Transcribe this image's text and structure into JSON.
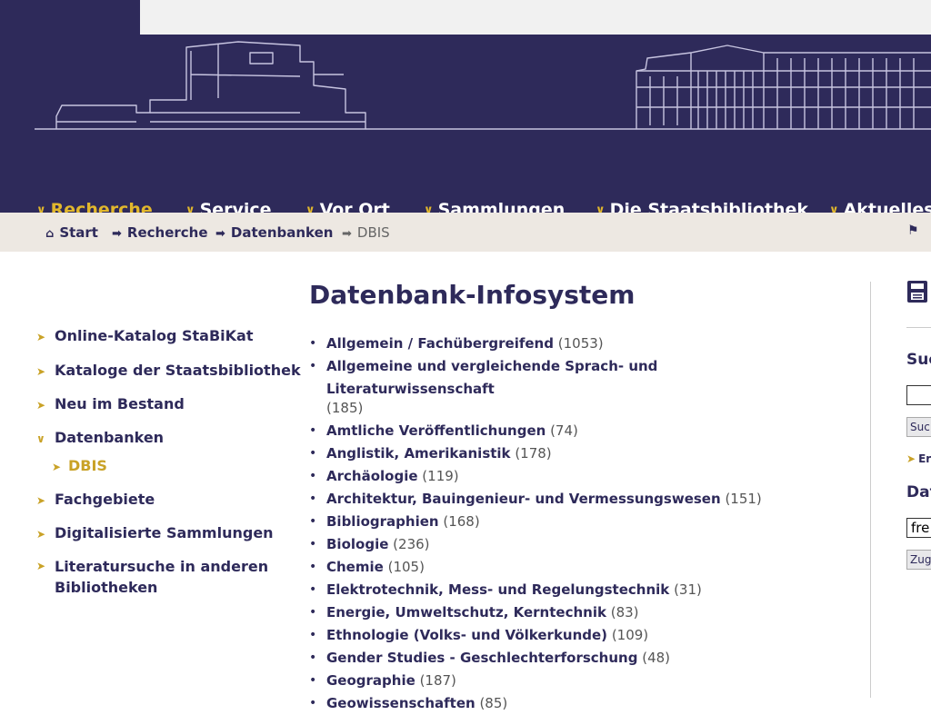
{
  "main_nav": [
    {
      "label": "Recherche",
      "active": true
    },
    {
      "label": "Service",
      "active": false
    },
    {
      "label": "Vor Ort",
      "active": false
    },
    {
      "label": "Sammlungen",
      "active": false
    },
    {
      "label": "Die Staatsbibliothek",
      "active": false
    },
    {
      "label": "Aktuelles",
      "active": false
    }
  ],
  "breadcrumb": [
    "Start",
    "Recherche",
    "Datenbanken",
    "DBIS"
  ],
  "sidebar": {
    "items": [
      {
        "label": "Online-Katalog StaBiKat"
      },
      {
        "label": "Kataloge der Staatsbibliothek"
      },
      {
        "label": "Neu im Bestand"
      },
      {
        "label": "Datenbanken",
        "expanded": true
      },
      {
        "label": "Fachgebiete"
      },
      {
        "label": "Digitalisierte Sammlungen"
      },
      {
        "label": "Literatursuche in anderen Bibliotheken"
      }
    ],
    "sub_item": "DBIS"
  },
  "page_title": "Datenbank-Infosystem",
  "subjects": [
    {
      "name": "Allgemein / Fachübergreifend",
      "count": "(1053)"
    },
    {
      "name": "Allgemeine und vergleichende Sprach- und Literaturwissenschaft",
      "count": "(185)"
    },
    {
      "name": "Amtliche Veröffentlichungen",
      "count": "(74)"
    },
    {
      "name": "Anglistik, Amerikanistik",
      "count": "(178)"
    },
    {
      "name": "Archäologie",
      "count": "(119)"
    },
    {
      "name": "Architektur, Bauingenieur- und Vermessungswesen",
      "count": "(151)"
    },
    {
      "name": "Bibliographien",
      "count": "(168)"
    },
    {
      "name": "Biologie",
      "count": "(236)"
    },
    {
      "name": "Chemie",
      "count": "(105)"
    },
    {
      "name": "Elektrotechnik, Mess- und Regelungstechnik",
      "count": "(31)"
    },
    {
      "name": "Energie, Umweltschutz, Kerntechnik",
      "count": "(83)"
    },
    {
      "name": "Ethnologie (Volks- und Völkerkunde)",
      "count": "(109)"
    },
    {
      "name": "Gender Studies - Geschlechterforschung",
      "count": "(48)"
    },
    {
      "name": "Geographie",
      "count": "(187)"
    },
    {
      "name": "Geowissenschaften",
      "count": "(85)"
    }
  ],
  "right_panel": {
    "search_heading": "Suc",
    "search_value": "",
    "search_button": "Suc",
    "link": "Er",
    "db_heading": "Dat",
    "db_value": "fre",
    "db_button": "Zug"
  },
  "colors": {
    "primary": "#2e2a5a",
    "accent": "#e1b72c",
    "breadcrumb_bg": "#ede8e2"
  },
  "icons": {
    "breadcrumb_home": "home-icon",
    "breadcrumb_separator": "arrow-right-icon",
    "nav": "chevron-down-icon",
    "print": "print-icon",
    "flag": "flag-icon"
  }
}
